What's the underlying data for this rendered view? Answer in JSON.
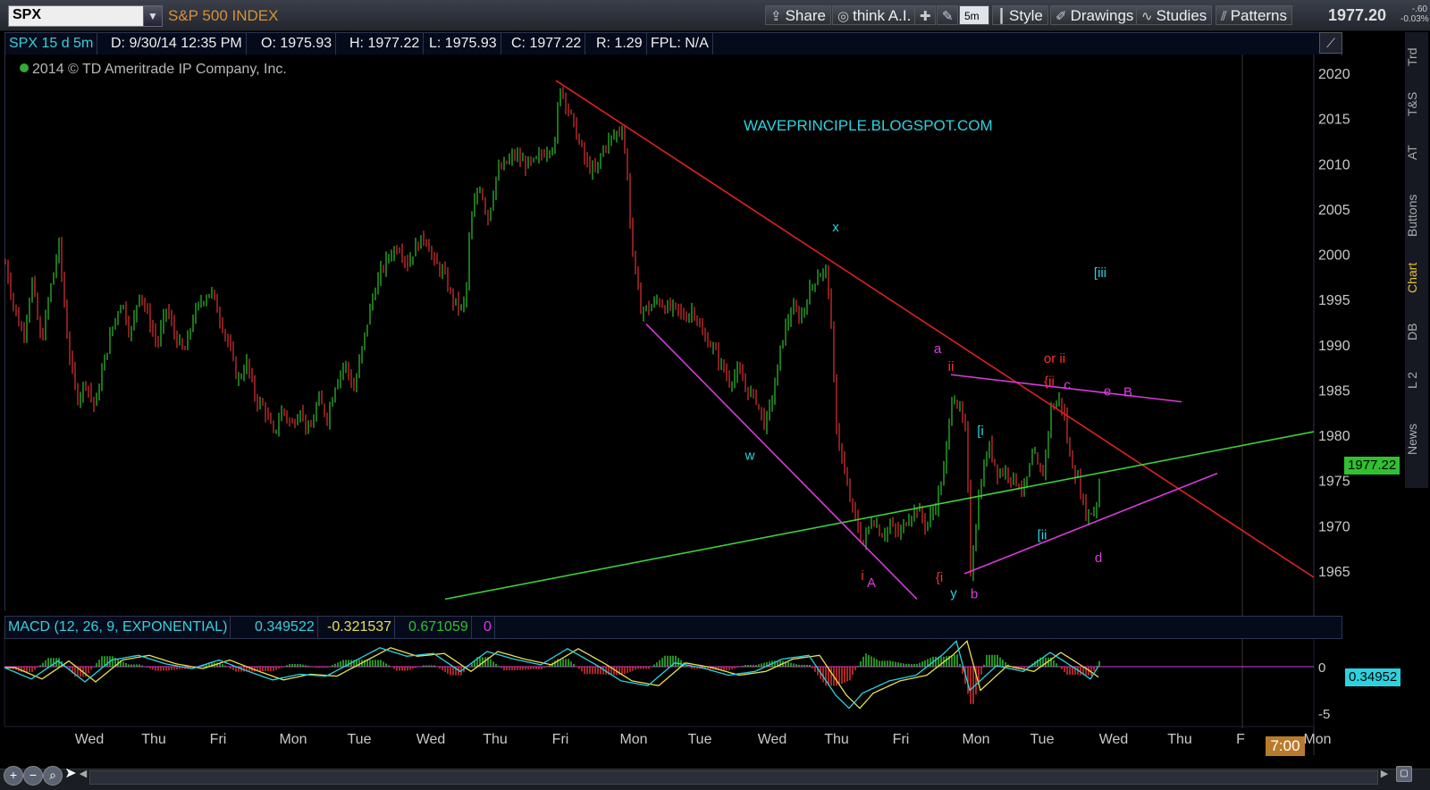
{
  "toolbar": {
    "symbol": "SPX",
    "index_name": "S&P 500 INDEX",
    "share": "Share",
    "think_ai": "think A.I.",
    "interval": "5m",
    "style": "Style",
    "drawings": "Drawings",
    "studies": "Studies",
    "patterns": "Patterns",
    "last_price": "1977.20",
    "change": "-.60",
    "change_pct": "-0.03%"
  },
  "info": {
    "symbol": "SPX 15 d 5m",
    "date": "D: 9/30/14 12:35 PM",
    "open": "O: 1975.93",
    "high": "H: 1977.22",
    "low": "L: 1975.93",
    "close": "C: 1977.22",
    "range": "R: 1.29",
    "fpl": "FPL: N/A"
  },
  "copyright": "2014 © TD Ameritrade IP Company, Inc.",
  "watermark": "WAVEPRINCIPLE.BLOGSPOT.COM",
  "price_tag": "1977.22",
  "macd": {
    "label": "MACD (12, 26, 9, EXPONENTIAL)",
    "value": "0.349522",
    "avg": "-0.321537",
    "diff": "0.671059",
    "zero": "0",
    "price_tag": "0.34952"
  },
  "time_box": "7:00",
  "right_tabs": [
    "Trd",
    "T&S",
    "AT",
    "Buttons",
    "Chart",
    "DB",
    "L 2",
    "News"
  ],
  "colors": {
    "up_bar": "#2fc12f",
    "down_bar": "#e03232",
    "trendline_red": "#e02020",
    "trendline_green": "#3ccf3c",
    "trendline_magenta": "#d83ad8",
    "label_cyan": "#2ad3e0",
    "label_red": "#ff3030",
    "label_magenta": "#e03ae0",
    "macd_line": "#2ad3e0",
    "macd_avg": "#e8e050"
  },
  "chart_data": {
    "type": "candlestick",
    "title": "S&P 500 INDEX",
    "y_ticks": [
      2020,
      2015,
      2010,
      2005,
      2000,
      1995,
      1990,
      1985,
      1980,
      1975,
      1970,
      1965
    ],
    "ylim": [
      1961.9,
      2022
    ],
    "x_ticks": [
      "Wed",
      "Thu",
      "Fri",
      "Mon",
      "Tue",
      "Wed",
      "Thu",
      "Fri",
      "Mon",
      "Tue",
      "Wed",
      "Thu",
      "Fri",
      "Mon",
      "Tue",
      "Wed",
      "Thu",
      "F",
      "Mon"
    ],
    "macd_ticks": [
      "0",
      "-5"
    ],
    "series": [
      {
        "name": "price_path",
        "points": [
          [
            0,
            1999
          ],
          [
            10,
            1994
          ],
          [
            20,
            1991
          ],
          [
            30,
            1997
          ],
          [
            40,
            1990
          ],
          [
            50,
            1996
          ],
          [
            60,
            2001
          ],
          [
            70,
            1990
          ],
          [
            80,
            1984
          ],
          [
            90,
            1986
          ],
          [
            100,
            1983
          ],
          [
            110,
            1988
          ],
          [
            120,
            1992
          ],
          [
            130,
            1995
          ],
          [
            140,
            1991
          ],
          [
            150,
            1996
          ],
          [
            160,
            1993
          ],
          [
            170,
            1990
          ],
          [
            180,
            1994
          ],
          [
            190,
            1991
          ],
          [
            200,
            1989
          ],
          [
            210,
            1993
          ],
          [
            220,
            1995
          ],
          [
            230,
            1996
          ],
          [
            240,
            1993
          ],
          [
            250,
            1990
          ],
          [
            260,
            1986
          ],
          [
            270,
            1988
          ],
          [
            280,
            1984
          ],
          [
            290,
            1983
          ],
          [
            300,
            1980
          ],
          [
            310,
            1983
          ],
          [
            320,
            1981
          ],
          [
            330,
            1983
          ],
          [
            340,
            1980
          ],
          [
            350,
            1984
          ],
          [
            360,
            1982
          ],
          [
            370,
            1986
          ],
          [
            380,
            1988
          ],
          [
            390,
            1985
          ],
          [
            400,
            1990
          ],
          [
            410,
            1995
          ],
          [
            420,
            1998
          ],
          [
            430,
            2000
          ],
          [
            440,
            2001
          ],
          [
            450,
            1999
          ],
          [
            460,
            2001
          ],
          [
            470,
            2002
          ],
          [
            480,
            1999
          ],
          [
            490,
            1998
          ],
          [
            500,
            1995
          ],
          [
            510,
            1994
          ],
          [
            515,
            1995
          ],
          [
            520,
            2003
          ],
          [
            530,
            2008
          ],
          [
            540,
            2004
          ],
          [
            550,
            2009
          ],
          [
            560,
            2010
          ],
          [
            570,
            2011
          ],
          [
            580,
            2010
          ],
          [
            590,
            2010
          ],
          [
            600,
            2011
          ],
          [
            610,
            2012
          ],
          [
            615,
            2012
          ],
          [
            620,
            2019
          ],
          [
            630,
            2016
          ],
          [
            640,
            2013
          ],
          [
            650,
            2010
          ],
          [
            660,
            2009
          ],
          [
            670,
            2012
          ],
          [
            680,
            2013
          ],
          [
            690,
            2014
          ],
          [
            695,
            2010
          ],
          [
            700,
            2002
          ],
          [
            710,
            1994
          ],
          [
            720,
            1994
          ],
          [
            730,
            1995
          ],
          [
            740,
            1994
          ],
          [
            750,
            1994
          ],
          [
            760,
            1993
          ],
          [
            770,
            1994
          ],
          [
            780,
            1991
          ],
          [
            790,
            1990
          ],
          [
            800,
            1988
          ],
          [
            810,
            1986
          ],
          [
            820,
            1987
          ],
          [
            830,
            1985
          ],
          [
            840,
            1984
          ],
          [
            850,
            1981
          ],
          [
            860,
            1985
          ],
          [
            870,
            1991
          ],
          [
            880,
            1994
          ],
          [
            890,
            1993
          ],
          [
            900,
            1996
          ],
          [
            910,
            1998
          ],
          [
            920,
            1998
          ],
          [
            930,
            1981
          ],
          [
            940,
            1975
          ],
          [
            950,
            1971
          ],
          [
            960,
            1968
          ],
          [
            970,
            1971
          ],
          [
            980,
            1969
          ],
          [
            990,
            1970
          ],
          [
            1000,
            1969
          ],
          [
            1010,
            1971
          ],
          [
            1020,
            1972
          ],
          [
            1030,
            1970
          ],
          [
            1040,
            1972
          ],
          [
            1050,
            1976
          ],
          [
            1060,
            1985
          ],
          [
            1070,
            1982
          ],
          [
            1075,
            1980
          ],
          [
            1080,
            1965
          ],
          [
            1090,
            1974
          ],
          [
            1100,
            1979
          ],
          [
            1110,
            1976
          ],
          [
            1120,
            1976
          ],
          [
            1130,
            1975
          ],
          [
            1140,
            1974
          ],
          [
            1150,
            1978
          ],
          [
            1160,
            1975
          ],
          [
            1170,
            1983
          ],
          [
            1180,
            1984
          ],
          [
            1185,
            1982
          ],
          [
            1190,
            1978
          ],
          [
            1200,
            1975
          ],
          [
            1210,
            1971
          ],
          [
            1220,
            1972
          ],
          [
            1226,
            1976
          ]
        ]
      },
      {
        "name": "MACD",
        "points": [
          [
            0,
            -0.1
          ],
          [
            30,
            -1.3
          ],
          [
            60,
            0.6
          ],
          [
            90,
            -1.6
          ],
          [
            120,
            0.7
          ],
          [
            150,
            1.2
          ],
          [
            180,
            0.3
          ],
          [
            210,
            -0.2
          ],
          [
            240,
            0.7
          ],
          [
            270,
            -0.4
          ],
          [
            300,
            -1.4
          ],
          [
            330,
            -0.8
          ],
          [
            360,
            -1.0
          ],
          [
            390,
            0.5
          ],
          [
            420,
            2.0
          ],
          [
            450,
            1.1
          ],
          [
            480,
            1.4
          ],
          [
            510,
            -0.5
          ],
          [
            540,
            1.6
          ],
          [
            570,
            0.8
          ],
          [
            600,
            0.2
          ],
          [
            630,
            1.9
          ],
          [
            660,
            0.3
          ],
          [
            690,
            -1.5
          ],
          [
            720,
            -2.0
          ],
          [
            750,
            0.4
          ],
          [
            780,
            -0.1
          ],
          [
            810,
            -0.9
          ],
          [
            840,
            -0.5
          ],
          [
            870,
            0.8
          ],
          [
            900,
            1.2
          ],
          [
            930,
            -3.0
          ],
          [
            945,
            -4.4
          ],
          [
            960,
            -2.8
          ],
          [
            990,
            -1.5
          ],
          [
            1020,
            -0.9
          ],
          [
            1050,
            1.3
          ],
          [
            1065,
            2.7
          ],
          [
            1080,
            -2.5
          ],
          [
            1110,
            0.1
          ],
          [
            1140,
            -0.5
          ],
          [
            1170,
            1.5
          ],
          [
            1200,
            -0.3
          ],
          [
            1215,
            -1.3
          ],
          [
            1226,
            0.35
          ]
        ]
      }
    ],
    "annotations": [
      {
        "text": "x",
        "price": 2003
      },
      {
        "text": "w",
        "price": 1977.8
      },
      {
        "text": "i",
        "price": 1964.5
      },
      {
        "text": "A",
        "price": 1963.7
      },
      {
        "text": "{i",
        "price": 1964.3
      },
      {
        "text": "y",
        "price": 1962.6
      },
      {
        "text": "b",
        "price": 1962.5
      },
      {
        "text": "a",
        "price": 1989.6
      },
      {
        "text": "ii",
        "price": 1987.6
      },
      {
        "text": "[i",
        "price": 1980.5
      },
      {
        "text": "or ii",
        "price": 1988.5
      },
      {
        "text": "{ii",
        "price": 1986.0
      },
      {
        "text": "c",
        "price": 1985.6
      },
      {
        "text": "e",
        "price": 1984.9
      },
      {
        "text": "B",
        "price": 1984.8
      },
      {
        "text": "[ii",
        "price": 1969.0
      },
      {
        "text": "d",
        "price": 1966.5
      },
      {
        "text": "[iii",
        "price": 1998.0
      }
    ]
  }
}
